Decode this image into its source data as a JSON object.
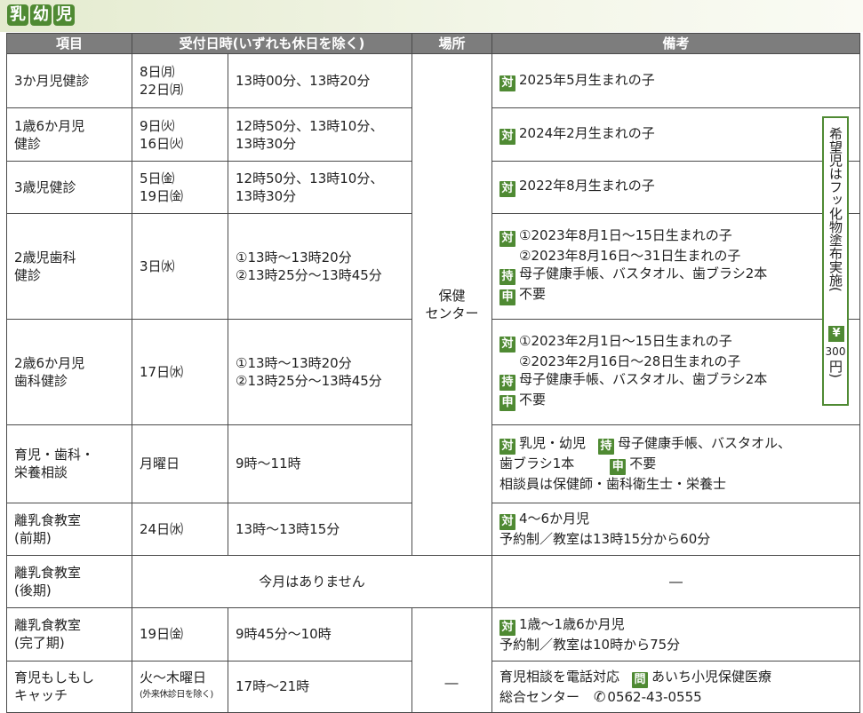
{
  "section_title": [
    "乳",
    "幼",
    "児"
  ],
  "headers": {
    "item": "項目",
    "datetime": "受付日時(いずれも休日を除く)",
    "place": "場所",
    "notes": "備考"
  },
  "badges": {
    "target": "対",
    "bring": "持",
    "apply": "申",
    "inquiry": "問",
    "yen": "¥"
  },
  "shared_place": [
    "保健",
    "センター"
  ],
  "rows": [
    {
      "item": [
        "3か月児健診"
      ],
      "date": [
        "8日㈪",
        "22日㈪"
      ],
      "time": [
        "13時00分、13時20分"
      ],
      "target": "2025年5月生まれの子"
    },
    {
      "item": [
        "1歳6か月児",
        "健診"
      ],
      "date": [
        "9日㈫",
        "16日㈫"
      ],
      "time": [
        "12時50分、13時10分、",
        "13時30分"
      ],
      "target": "2024年2月生まれの子"
    },
    {
      "item": [
        "3歳児健診"
      ],
      "date": [
        "5日㈮",
        "19日㈮"
      ],
      "time": [
        "12時50分、13時10分、",
        "13時30分"
      ],
      "target": "2022年8月生まれの子"
    },
    {
      "item": [
        "2歳児歯科",
        "健診"
      ],
      "date": [
        "3日㈬"
      ],
      "time": [
        "①13時～13時20分",
        "②13時25分～13時45分"
      ],
      "target": [
        "①2023年8月1日～15日生まれの子",
        "②2023年8月16日～31日生まれの子"
      ],
      "bring": "母子健康手帳、バスタオル、歯ブラシ2本",
      "apply": "不要"
    },
    {
      "item": [
        "2歳6か月児",
        "歯科健診"
      ],
      "date": [
        "17日㈬"
      ],
      "time": [
        "①13時～13時20分",
        "②13時25分～13時45分"
      ],
      "target": [
        "①2023年2月1日～15日生まれの子",
        "②2023年2月16日～28日生まれの子"
      ],
      "bring": "母子健康手帳、バスタオル、歯ブラシ2本",
      "apply": "不要"
    },
    {
      "item": [
        "育児・歯科・",
        "栄養相談"
      ],
      "date": [
        "月曜日"
      ],
      "time": [
        "9時～11時"
      ],
      "target": "乳児・幼児",
      "bring": [
        "母子健康手帳、バスタオル、",
        "歯ブラシ1本"
      ],
      "apply": "不要",
      "extra": "相談員は保健師・歯科衛生士・栄養士"
    },
    {
      "item": [
        "離乳食教室",
        "(前期)"
      ],
      "date": [
        "24日㈬"
      ],
      "time": [
        "13時～13時15分"
      ],
      "target": "4～6か月児",
      "extra": "予約制／教室は13時15分から60分"
    },
    {
      "item": [
        "離乳食教室",
        "(後期)"
      ],
      "merged": "今月はありません",
      "notes_dash": "―"
    },
    {
      "item": [
        "離乳食教室",
        "(完了期)"
      ],
      "date": [
        "19日㈮"
      ],
      "time": [
        "9時45分～10時"
      ],
      "target": "1歳～1歳6か月児",
      "extra": "予約制／教室は10時から75分"
    },
    {
      "item": [
        "育児もしもし",
        "キャッチ"
      ],
      "date": [
        "火～木曜日",
        "(外来休診日を除く)"
      ],
      "time": [
        "17時～21時"
      ],
      "place": "―",
      "notes": [
        "育児相談を電話対応",
        "あいち小児保健医療",
        "総合センター",
        "0562-43-0555"
      ]
    }
  ],
  "fluoride_note": {
    "text": "希望児はフッ化物塗布実施(",
    "price": "300",
    "close": "円)"
  }
}
